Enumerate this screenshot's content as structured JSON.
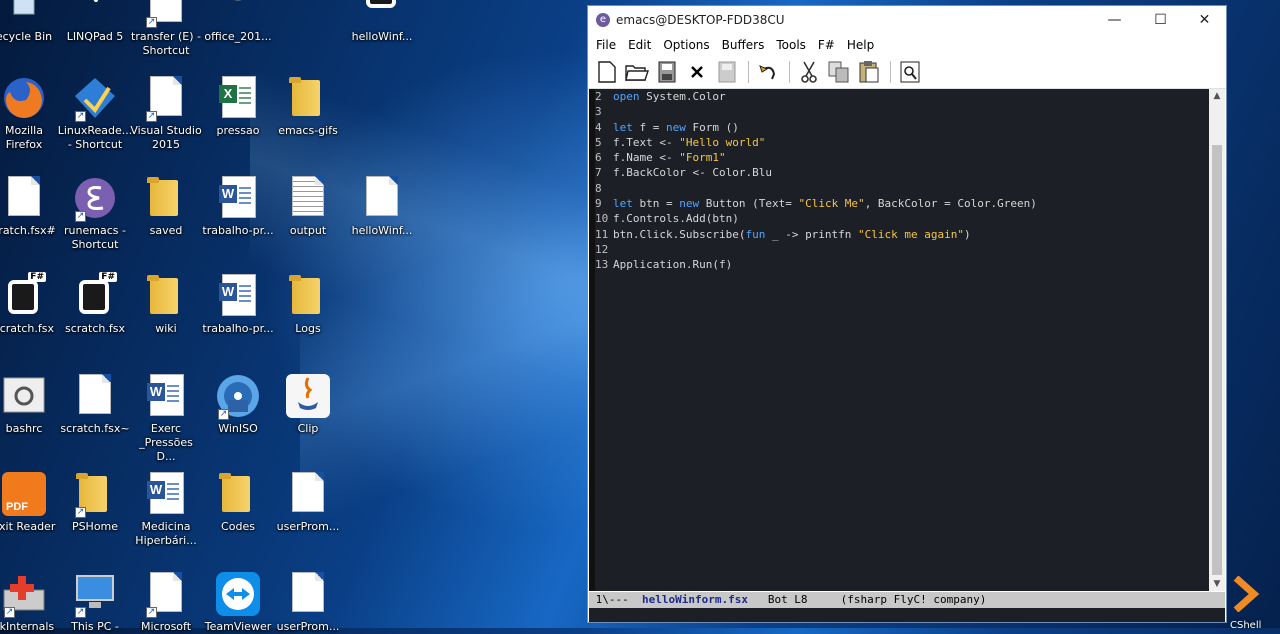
{
  "desktop": {
    "icons": [
      {
        "label": "ecycle Bin"
      },
      {
        "label": "LINQPad 5"
      },
      {
        "label": "transfer (E) -\nShortcut"
      },
      {
        "label": "office_201..."
      },
      {
        "label": "helloWinf..."
      },
      {
        "label": "Mozilla\nFirefox"
      },
      {
        "label": "LinuxReade...\n- Shortcut"
      },
      {
        "label": "Visual Studio\n2015"
      },
      {
        "label": "pressao"
      },
      {
        "label": "emacs-gifs"
      },
      {
        "label": "cratch.fsx#"
      },
      {
        "label": "runemacs -\nShortcut"
      },
      {
        "label": "saved"
      },
      {
        "label": "trabalho-pr..."
      },
      {
        "label": "output"
      },
      {
        "label": "helloWinf..."
      },
      {
        "label": "scratch.fsx"
      },
      {
        "label": "scratch.fsx"
      },
      {
        "label": "wiki"
      },
      {
        "label": "trabalho-pr..."
      },
      {
        "label": "Logs"
      },
      {
        "label": "bashrc"
      },
      {
        "label": "scratch.fsx~"
      },
      {
        "label": "Exerc\n_Pressões D..."
      },
      {
        "label": "WinISO"
      },
      {
        "label": "Clip"
      },
      {
        "label": "oxit Reader"
      },
      {
        "label": "PSHome"
      },
      {
        "label": "Medicina\nHiperbári..."
      },
      {
        "label": "Codes"
      },
      {
        "label": "userProm..."
      },
      {
        "label": "skInternals"
      },
      {
        "label": "This PC -"
      },
      {
        "label": "Microsoft"
      },
      {
        "label": "TeamViewer"
      },
      {
        "label": "userProm..."
      }
    ],
    "powershell_label": "CShell"
  },
  "window": {
    "title": "emacs@DESKTOP-FDD38CU",
    "controls": {
      "minimize": "—",
      "maximize": "☐",
      "close": "✕"
    },
    "menu": [
      "File",
      "Edit",
      "Options",
      "Buffers",
      "Tools",
      "F#",
      "Help"
    ],
    "toolbar": [
      "new-file",
      "open-folder",
      "save",
      "close-buffer",
      "save-disabled",
      "undo",
      "cut",
      "copy",
      "paste",
      "search"
    ]
  },
  "editor": {
    "lines": [
      {
        "n": "2",
        "tokens": [
          {
            "t": "open",
            "k": "kw"
          },
          {
            "t": " System.Color",
            "k": ""
          }
        ]
      },
      {
        "n": "3",
        "tokens": []
      },
      {
        "n": "4",
        "tokens": [
          {
            "t": "let",
            "k": "kw"
          },
          {
            "t": " f = ",
            "k": ""
          },
          {
            "t": "new",
            "k": "kw"
          },
          {
            "t": " Form ()",
            "k": ""
          }
        ]
      },
      {
        "n": "5",
        "tokens": [
          {
            "t": "f.Text <- ",
            "k": ""
          },
          {
            "t": "\"Hello world\"",
            "k": "str"
          }
        ]
      },
      {
        "n": "6",
        "tokens": [
          {
            "t": "f.Name <- ",
            "k": ""
          },
          {
            "t": "\"Form1\"",
            "k": "str"
          }
        ]
      },
      {
        "n": "7",
        "tokens": [
          {
            "t": "f.BackColor <- Color.Blu",
            "k": ""
          }
        ]
      },
      {
        "n": "8",
        "tokens": []
      },
      {
        "n": "9",
        "tokens": [
          {
            "t": "let",
            "k": "kw"
          },
          {
            "t": " btn = ",
            "k": ""
          },
          {
            "t": "new",
            "k": "kw"
          },
          {
            "t": " Button (Text= ",
            "k": ""
          },
          {
            "t": "\"Click Me\"",
            "k": "str"
          },
          {
            "t": ", BackColor = Color.Green)",
            "k": ""
          }
        ]
      },
      {
        "n": "10",
        "tokens": [
          {
            "t": "f.Controls.Add(btn)",
            "k": ""
          }
        ]
      },
      {
        "n": "11",
        "tokens": [
          {
            "t": "btn.Click.Subscribe(",
            "k": ""
          },
          {
            "t": "fun",
            "k": "kw"
          },
          {
            "t": " _ -> printfn ",
            "k": ""
          },
          {
            "t": "\"Click me again\"",
            "k": "str"
          },
          {
            "t": ")",
            "k": ""
          }
        ]
      },
      {
        "n": "12",
        "tokens": []
      },
      {
        "n": "13",
        "tokens": [
          {
            "t": "Application.Run(f)",
            "k": ""
          }
        ]
      }
    ]
  },
  "modeline": {
    "prefix": " 1\\---  ",
    "buffer": "helloWinform.fsx",
    "position": "   Bot L8     ",
    "modes": "(fsharp FlyC! company)"
  }
}
